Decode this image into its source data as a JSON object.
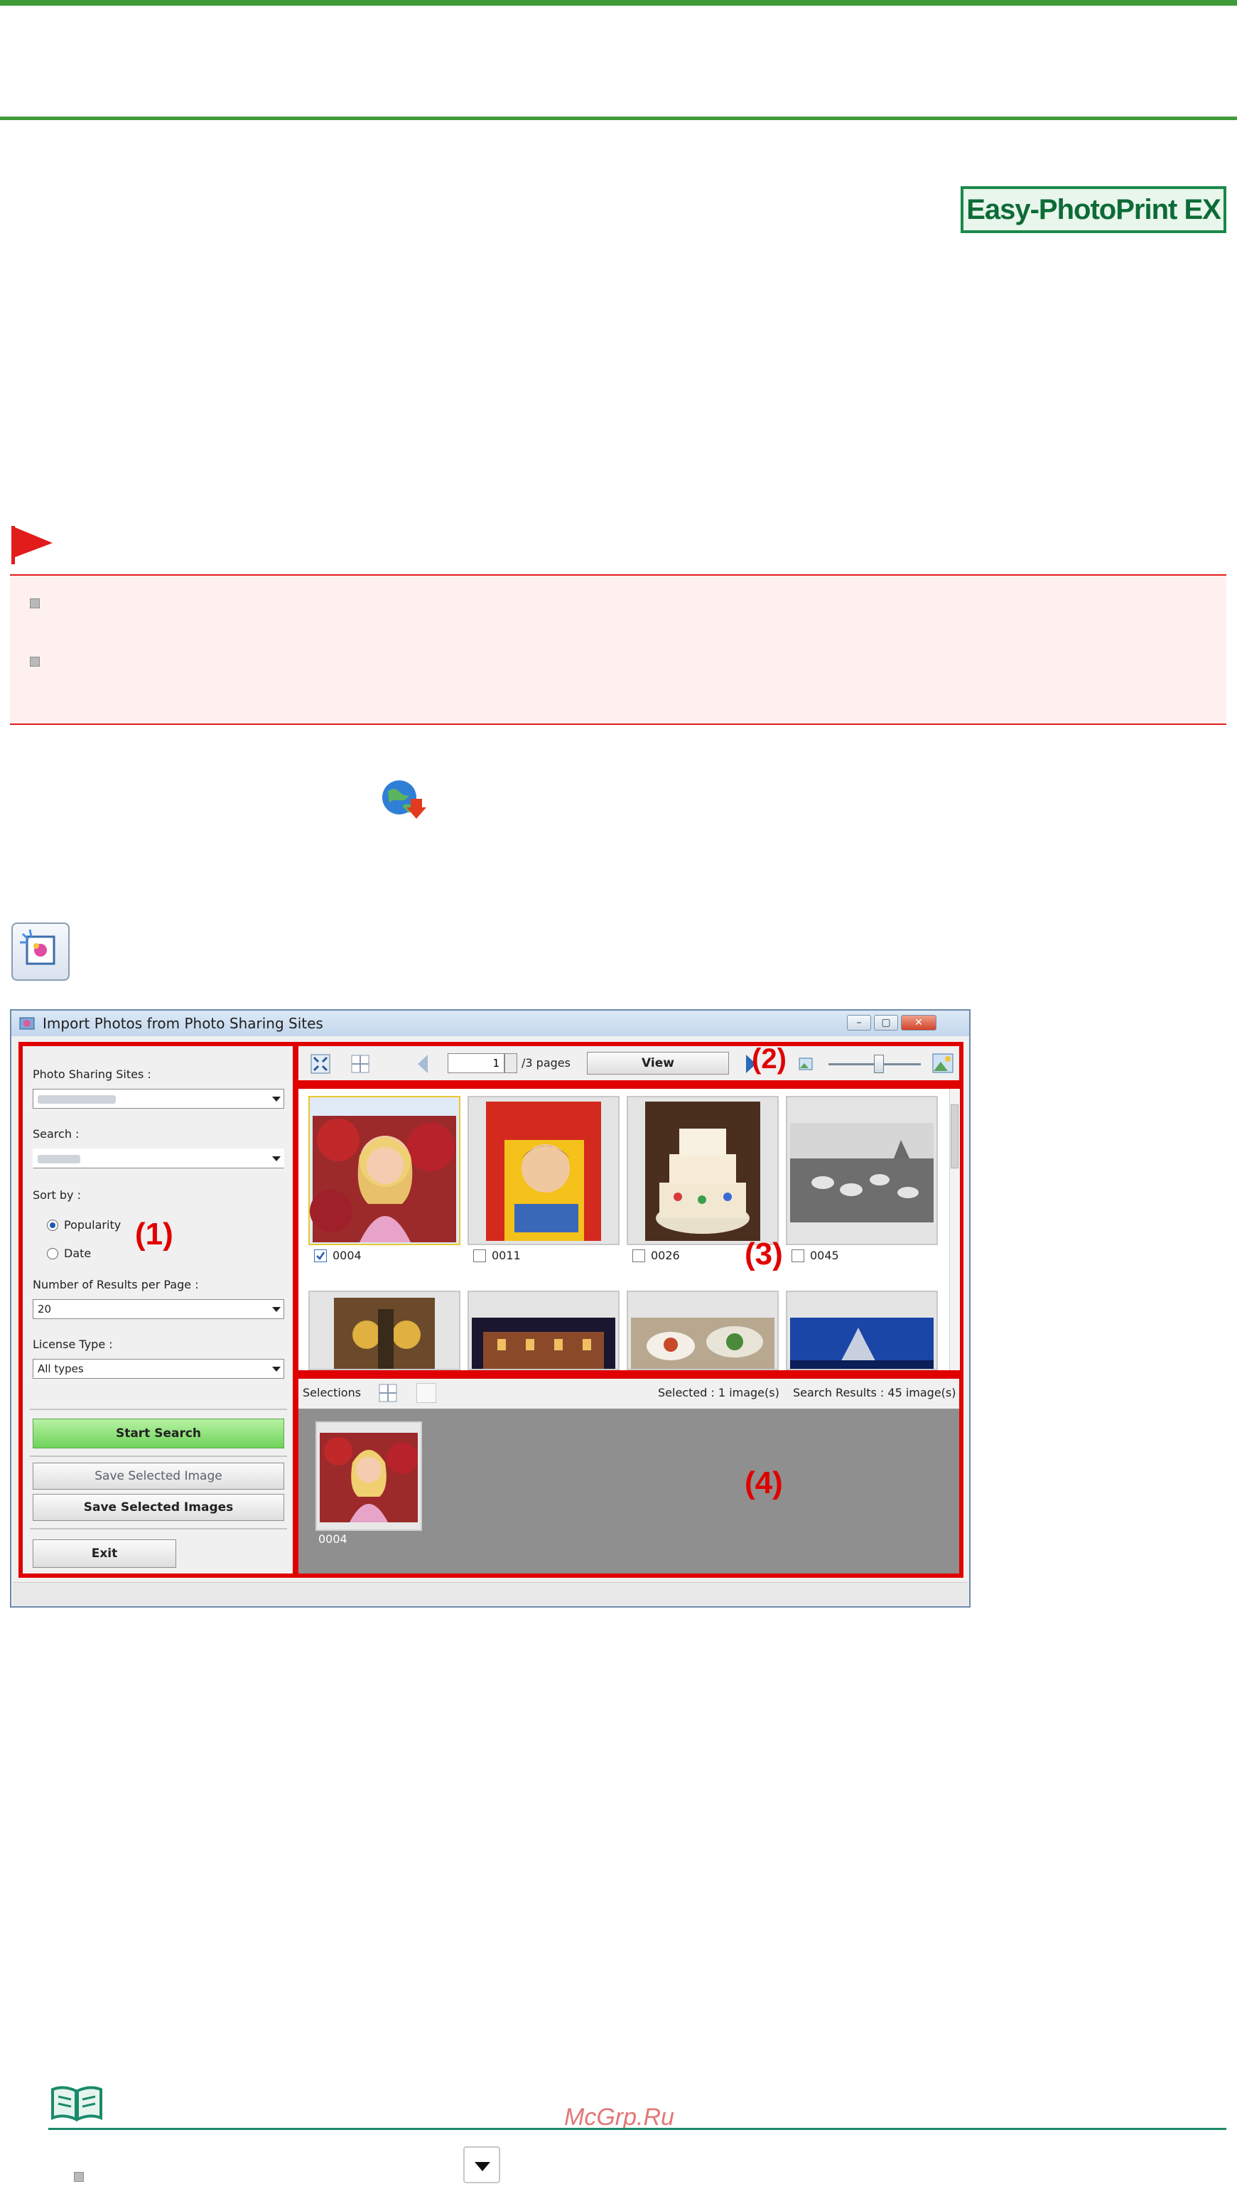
{
  "logo_text": "Easy-PhotoPrint EX",
  "window": {
    "title": "Import Photos from Photo Sharing Sites",
    "controls": [
      "–",
      "▢",
      "✕"
    ]
  },
  "left_panel": {
    "photo_sharing_sites_label": "Photo Sharing Sites :",
    "search_label": "Search :",
    "sort_by_label": "Sort by :",
    "sort_options": [
      "Popularity",
      "Date"
    ],
    "sort_selected": "Popularity",
    "results_per_page_label": "Number of Results per Page :",
    "results_per_page_value": "20",
    "license_type_label": "License Type :",
    "license_type_value": "All types",
    "start_search_label": "Start Search",
    "save_selected_image_label": "Save Selected Image",
    "save_selected_images_label": "Save Selected Images",
    "exit_label": "Exit"
  },
  "toolbar": {
    "page_value": "1",
    "pages_label": "/3 pages",
    "view_label": "View"
  },
  "thumbnails": [
    {
      "id": "0004",
      "checked": true
    },
    {
      "id": "0011",
      "checked": false
    },
    {
      "id": "0026",
      "checked": false
    },
    {
      "id": "0045",
      "checked": false
    }
  ],
  "selections": {
    "label": "Selections",
    "selected_count": "Selected : 1 image(s)",
    "search_results": "Search Results : 45 image(s)",
    "item_id": "0004"
  },
  "callouts": [
    "(1)",
    "(2)",
    "(3)",
    "(4)"
  ],
  "watermark": "McGrp.Ru",
  "colors": {
    "accent_green": "#3f9a3a",
    "callout_red": "#e00000",
    "caution_red": "#e21b1b"
  },
  "icons": [
    "caution-flag-icon",
    "globe-download-icon",
    "import-photos-icon",
    "note-book-icon",
    "dropdown-arrow-icon"
  ]
}
